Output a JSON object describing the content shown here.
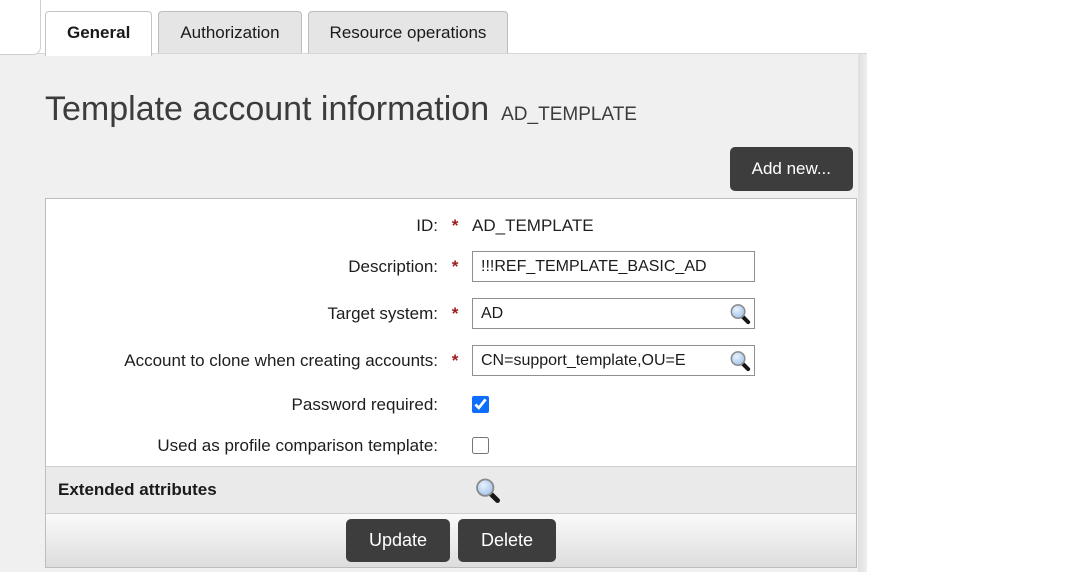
{
  "tabs": [
    {
      "label": "General",
      "active": true
    },
    {
      "label": "Authorization",
      "active": false
    },
    {
      "label": "Resource operations",
      "active": false
    }
  ],
  "header": {
    "title": "Template account information",
    "subtitle": "AD_TEMPLATE"
  },
  "toolbar": {
    "add_new_label": "Add new..."
  },
  "form": {
    "required_marker": "*",
    "fields": [
      {
        "label": "ID:",
        "required": true,
        "type": "static",
        "value": "AD_TEMPLATE"
      },
      {
        "label": "Description:",
        "required": true,
        "type": "text",
        "value": "!!!REF_TEMPLATE_BASIC_AD"
      },
      {
        "label": "Target system:",
        "required": true,
        "type": "lookup",
        "value": "AD"
      },
      {
        "label": "Account to clone when creating accounts:",
        "required": true,
        "type": "lookup",
        "value": "CN=support_template,OU=E"
      },
      {
        "label": "Password required:",
        "required": false,
        "type": "checkbox",
        "checked": true
      },
      {
        "label": "Used as profile comparison template:",
        "required": false,
        "type": "checkbox",
        "checked": false
      }
    ],
    "extended_section": {
      "label": "Extended attributes"
    },
    "actions": {
      "update_label": "Update",
      "delete_label": "Delete"
    }
  },
  "icons": {
    "lookup": "magnifier-icon"
  },
  "colors": {
    "button_bg": "#3d3d3d",
    "content_bg": "#f0f0f0",
    "checkbox_accent": "#0d6efd",
    "required_red": "#9b1c1c"
  }
}
